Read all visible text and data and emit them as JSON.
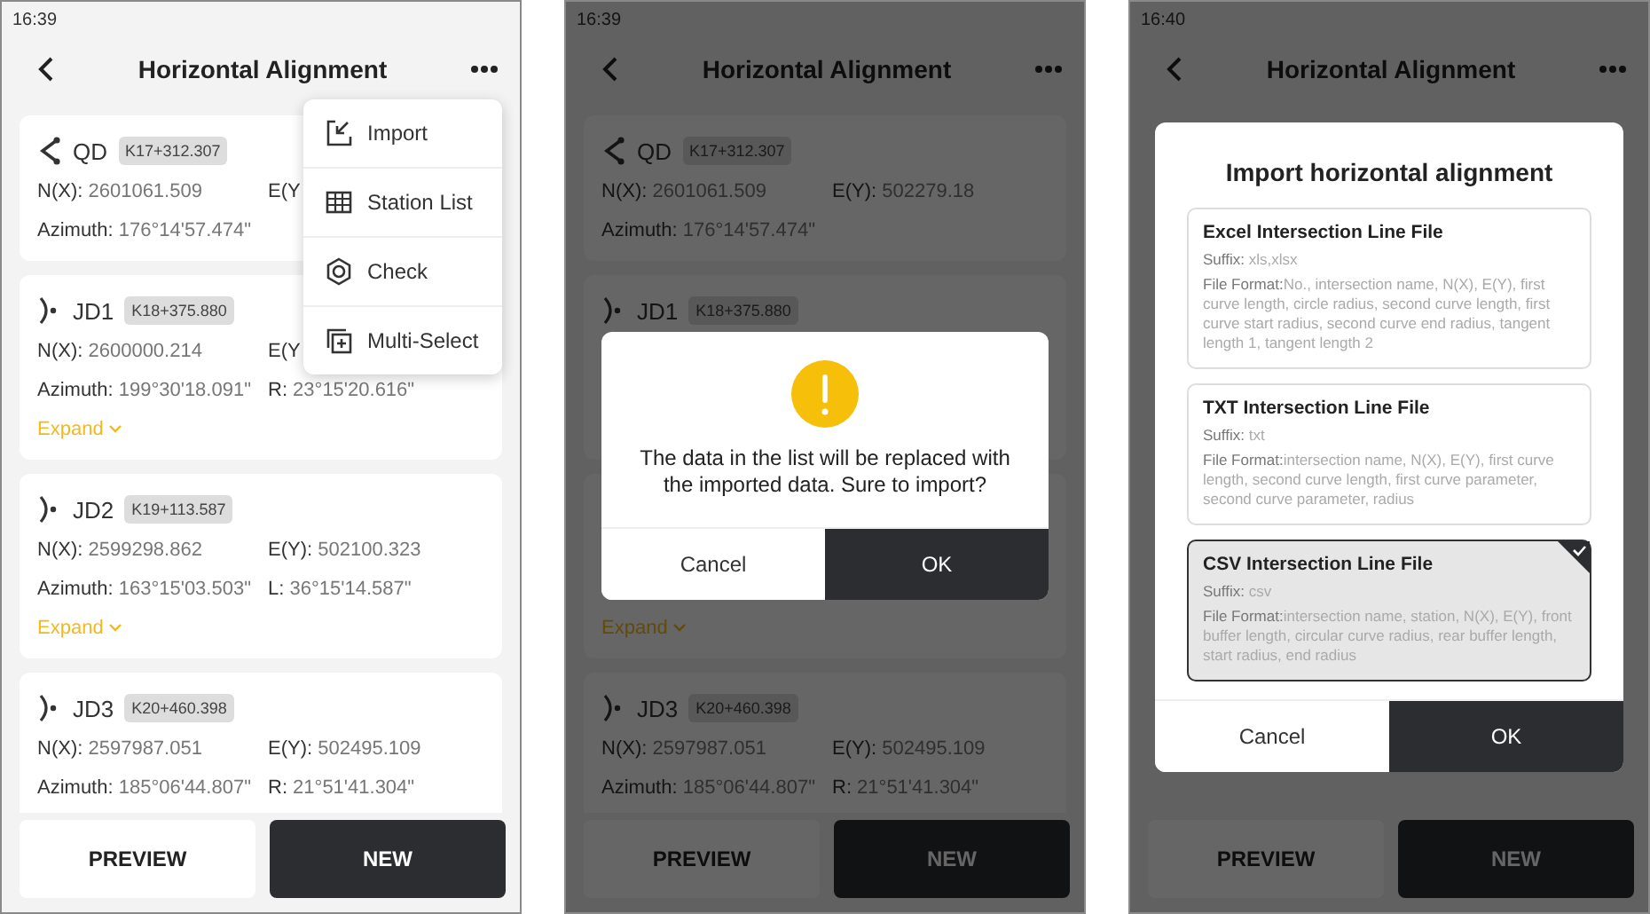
{
  "screens": [
    {
      "time": "16:39",
      "title": "Horizontal Alignment",
      "cards": [
        {
          "kind": "start",
          "name": "QD",
          "station": "K17+312.307",
          "line_1": [
            {
              "label": "N(X):",
              "value": "2601061.509"
            },
            {
              "label": "E(Y"
            }
          ],
          "line_2": [
            {
              "label": "Azimuth:",
              "value": "176°14'57.474\""
            }
          ]
        },
        {
          "kind": "intersection",
          "name": "JD1",
          "station": "K18+375.880",
          "line_1": [
            {
              "label": "N(X):",
              "value": "2600000.214"
            },
            {
              "label": "E(Y"
            }
          ],
          "line_2": [
            {
              "label": "Azimuth:",
              "value": "199°30'18.091\""
            },
            {
              "label": "R:",
              "value": "23°15'20.616\""
            }
          ],
          "expand": "Expand"
        },
        {
          "kind": "intersection",
          "name": "JD2",
          "station": "K19+113.587",
          "line_1": [
            {
              "label": "N(X):",
              "value": "2599298.862"
            },
            {
              "label": "E(Y):",
              "value": "502100.323"
            }
          ],
          "line_2": [
            {
              "label": "Azimuth:",
              "value": "163°15'03.503\""
            },
            {
              "label": "L:",
              "value": "36°15'14.587\""
            }
          ],
          "expand": "Expand"
        },
        {
          "kind": "intersection",
          "name": "JD3",
          "station": "K20+460.398",
          "line_1": [
            {
              "label": "N(X):",
              "value": "2597987.051"
            },
            {
              "label": "E(Y):",
              "value": "502495.109"
            }
          ],
          "line_2": [
            {
              "label": "Azimuth:",
              "value": "185°06'44.807\""
            },
            {
              "label": "R:",
              "value": "21°51'41.304\""
            }
          ]
        }
      ],
      "buttons": [
        {
          "kind": "secondary",
          "label": "PREVIEW"
        },
        {
          "kind": "primary",
          "label": "NEW"
        }
      ],
      "overlay": {
        "kind": "menu",
        "items": [
          {
            "label": "Import"
          },
          {
            "label": "Station List"
          },
          {
            "label": "Check"
          },
          {
            "label": "Multi-Select"
          }
        ]
      }
    },
    {
      "time": "16:39",
      "title": "Horizontal Alignment",
      "cards": [
        {
          "kind": "start",
          "name": "QD",
          "station": "K17+312.307",
          "line_1": [
            {
              "label": "N(X):",
              "value": "2601061.509"
            },
            {
              "label": "E(Y):",
              "value": "502279.18"
            }
          ],
          "line_2": [
            {
              "label": "Azimuth:",
              "value": "176°14'57.474\""
            }
          ]
        },
        {
          "kind": "intersection",
          "name": "JD1",
          "station": "K18+375.880"
        },
        {
          "kind": "intersection",
          "expand": "Expand"
        },
        {
          "kind": "intersection",
          "name": "JD3",
          "station": "K20+460.398",
          "line_1": [
            {
              "label": "N(X):",
              "value": "2597987.051"
            },
            {
              "label": "E(Y):",
              "value": "502495.109"
            }
          ],
          "line_2": [
            {
              "label": "Azimuth:",
              "value": "185°06'44.807\""
            },
            {
              "label": "R:",
              "value": "21°51'41.304\""
            }
          ]
        }
      ],
      "buttons": [
        {
          "kind": "secondary",
          "label": "PREVIEW"
        },
        {
          "kind": "primary",
          "label": "NEW"
        }
      ],
      "overlay": {
        "kind": "confirm",
        "message": "The data in the list will be replaced with the imported data. Sure to import?",
        "buttons": [
          {
            "kind": "secondary",
            "label": "Cancel"
          },
          {
            "kind": "primary",
            "label": "OK"
          }
        ]
      }
    },
    {
      "time": "16:40",
      "title": "Horizontal Alignment",
      "buttons": [
        {
          "kind": "secondary",
          "label": "PREVIEW"
        },
        {
          "kind": "primary",
          "label": "NEW"
        }
      ],
      "overlay": {
        "kind": "import",
        "title": "Import horizontal alignment",
        "options": [
          {
            "title": "Excel Intersection Line File",
            "suffix_label": "Suffix:",
            "suffix": "xls,xlsx",
            "format_label": "File Format:",
            "format": "No., intersection name, N(X), E(Y), first curve length, circle radius, second curve length, first curve start radius, second curve end radius, tangent length 1, tangent length 2",
            "selected": false
          },
          {
            "title": "TXT Intersection Line File",
            "suffix_label": "Suffix:",
            "suffix": "txt",
            "format_label": "File Format:",
            "format": "intersection name, N(X), E(Y), first curve length, second curve length, first curve parameter, second curve parameter, radius",
            "selected": false
          },
          {
            "title": "CSV Intersection Line File",
            "suffix_label": "Suffix:",
            "suffix": "csv",
            "format_label": "File Format:",
            "format": "intersection name, station, N(X), E(Y), front buffer length, circular curve radius, rear buffer length, start radius, end radius",
            "selected": true
          }
        ],
        "buttons": [
          {
            "kind": "secondary",
            "label": "Cancel"
          },
          {
            "kind": "primary",
            "label": "OK"
          }
        ]
      }
    }
  ]
}
